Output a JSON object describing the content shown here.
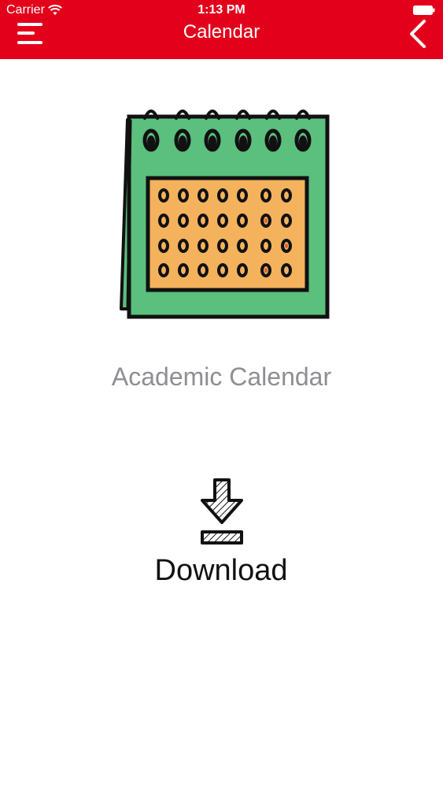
{
  "status_bar": {
    "carrier": "Carrier",
    "time": "1:13 PM"
  },
  "nav": {
    "title": "Calendar"
  },
  "content": {
    "calendar_label": "Academic Calendar",
    "download_label": "Download"
  },
  "colors": {
    "header": "#e3001b",
    "calendar_green": "#5bbf7e",
    "calendar_orange": "#f4b25c",
    "label_gray": "#8e8e93"
  },
  "icons": {
    "menu": "hamburger-icon",
    "back": "chevron-left-icon",
    "wifi": "wifi-icon",
    "battery": "battery-icon",
    "calendar": "calendar-illustration",
    "download": "download-arrow-icon"
  }
}
